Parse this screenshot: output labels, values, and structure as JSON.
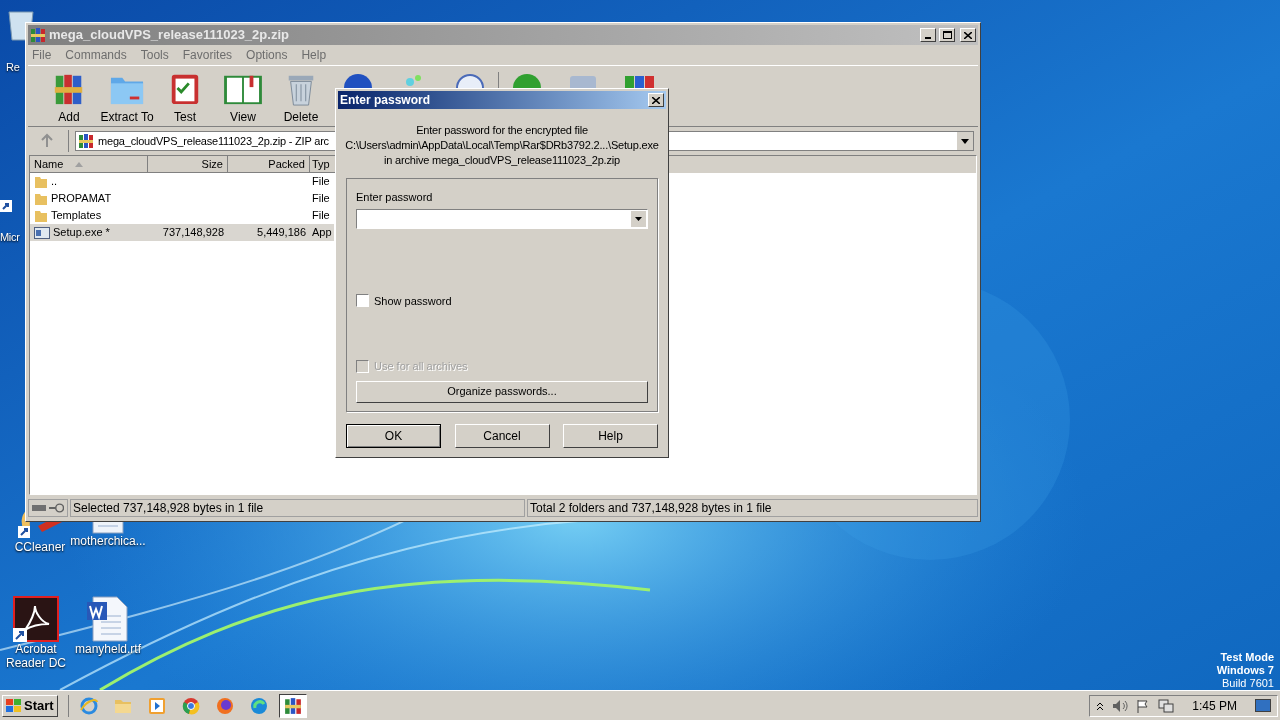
{
  "desktop": {
    "icons": [
      {
        "label": "Re",
        "kind": "bin"
      },
      {
        "label": "Micr",
        "kind": "shortcut"
      },
      {
        "label": "CCleaner",
        "kind": "cleaner"
      },
      {
        "label": "motherchica...",
        "kind": "document"
      },
      {
        "label": "Acrobat Reader DC",
        "kind": "acrobat"
      },
      {
        "label": "manyheld.rtf",
        "kind": "word"
      }
    ],
    "system_text": [
      "Test Mode",
      "Windows 7",
      "Build 7601"
    ]
  },
  "window": {
    "title": "mega_cloudVPS_release111023_2p.zip",
    "menu": [
      "File",
      "Commands",
      "Tools",
      "Favorites",
      "Options",
      "Help"
    ],
    "toolbar": [
      {
        "label": "Add",
        "kind": "add"
      },
      {
        "label": "Extract To",
        "kind": "extract"
      },
      {
        "label": "Test",
        "kind": "test"
      },
      {
        "label": "View",
        "kind": "view"
      },
      {
        "label": "Delete",
        "kind": "delete"
      }
    ],
    "address": "mega_cloudVPS_release111023_2p.zip - ZIP arc",
    "columns": [
      {
        "label": "Name",
        "sorted": true
      },
      {
        "label": "Size"
      },
      {
        "label": "Packed"
      },
      {
        "label": "Typ"
      }
    ],
    "rows": [
      {
        "name": "..",
        "kind": "folder",
        "type": "File",
        "selected": false
      },
      {
        "name": "PROPAMAT",
        "kind": "folder",
        "type": "File",
        "selected": false
      },
      {
        "name": "Templates",
        "kind": "folder",
        "type": "File",
        "selected": false
      },
      {
        "name": "Setup.exe *",
        "kind": "file",
        "size": "737,148,928",
        "packed": "5,449,186",
        "type": "App",
        "selected": true
      }
    ],
    "status_left": "Selected 737,148,928 bytes in 1 file",
    "status_right": "Total 2 folders and 737,148,928 bytes in 1 file"
  },
  "dialog": {
    "title": "Enter password",
    "message": [
      "Enter password for the encrypted file",
      "C:\\Users\\admin\\AppData\\Local\\Temp\\Rar$DRb3792.2...\\Setup.exe",
      "in archive mega_cloudVPS_release111023_2p.zip"
    ],
    "field_label": "Enter password",
    "checkboxes": [
      {
        "label": "Show password",
        "checked": false,
        "disabled": false
      },
      {
        "label": "Use for all archives",
        "checked": false,
        "disabled": true
      }
    ],
    "organize": "Organize passwords...",
    "buttons": [
      {
        "label": "OK",
        "default": true
      },
      {
        "label": "Cancel",
        "default": false
      },
      {
        "label": "Help",
        "default": false
      }
    ]
  },
  "taskbar": {
    "start": "Start",
    "apps": [
      {
        "kind": "ie",
        "active": false
      },
      {
        "kind": "explorer",
        "active": false
      },
      {
        "kind": "media",
        "active": false
      },
      {
        "kind": "chrome",
        "active": false
      },
      {
        "kind": "firefox",
        "active": false
      },
      {
        "kind": "edge",
        "active": false
      },
      {
        "kind": "winrar",
        "active": true
      }
    ],
    "time": "1:45 PM"
  }
}
